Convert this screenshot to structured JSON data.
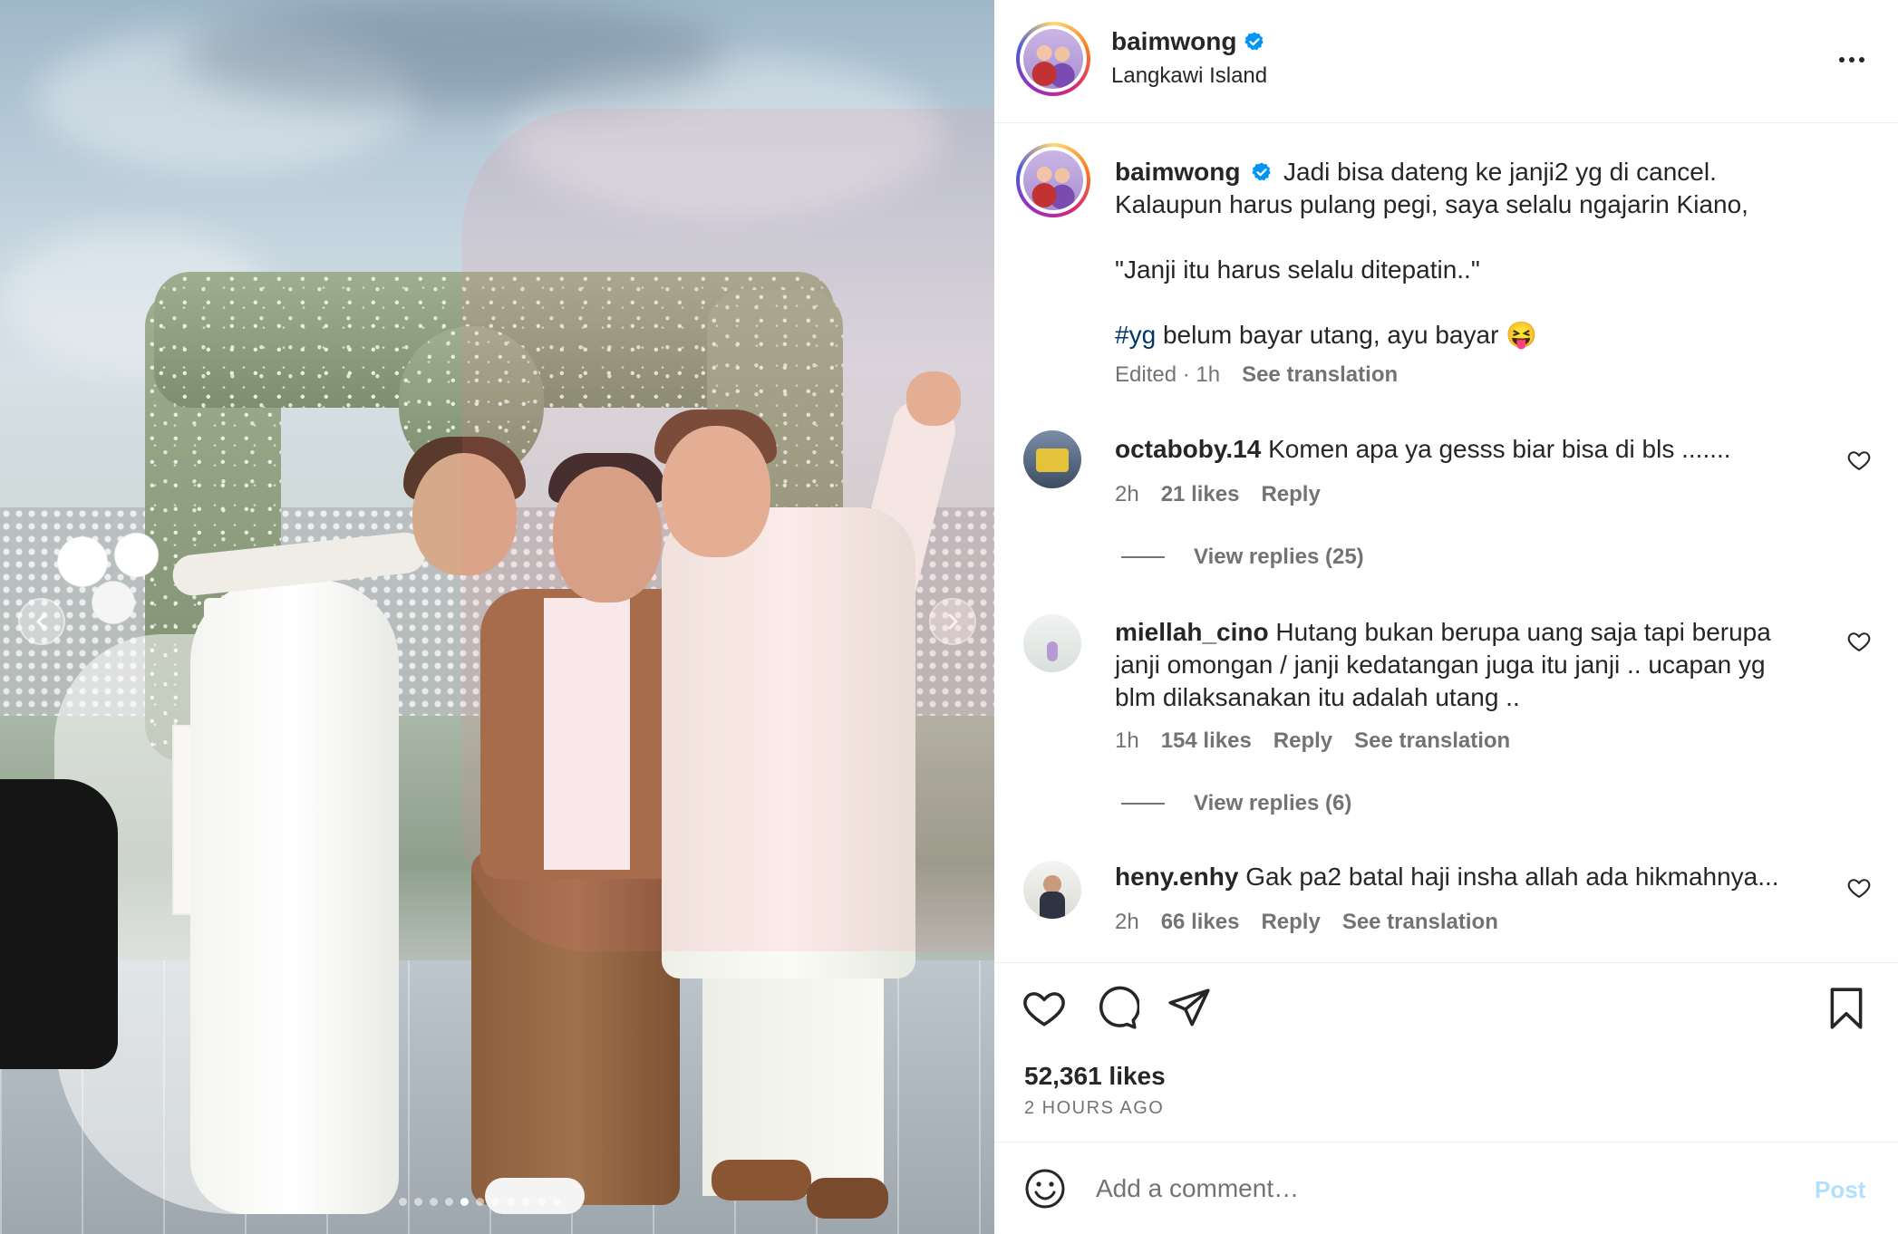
{
  "post": {
    "username": "baimwong",
    "location": "Langkawi Island",
    "caption": {
      "username": "baimwong",
      "line1": "Jadi bisa dateng ke janji2 yg di cancel.",
      "line2": "Kalaupun harus pulang pegi, saya selalu ngajarin Kiano,",
      "line3": "\"Janji itu harus selalu ditepatin..\"",
      "hashtag": "#yg",
      "line4_rest": "belum bayar utang, ayu bayar",
      "emoji": "😝",
      "edited": "Edited · 1h",
      "see_translation": "See translation"
    },
    "likes": "52,361 likes",
    "time_ago": "2 HOURS AGO"
  },
  "comments": [
    {
      "username": "octaboby.14",
      "text": "Komen apa ya gesss biar bisa di bls .......",
      "time": "2h",
      "likes": "21 likes",
      "reply": "Reply",
      "view_replies": "View replies (25)"
    },
    {
      "username": "miellah_cino",
      "text": "Hutang bukan berupa uang saja tapi berupa janji omongan / janji kedatangan juga itu janji .. ucapan yg blm dilaksanakan itu adalah utang ..",
      "time": "1h",
      "likes": "154 likes",
      "reply": "Reply",
      "see_translation": "See translation",
      "view_replies": "View replies (6)"
    },
    {
      "username": "heny.enhy",
      "text": "Gak pa2 batal haji insha allah ada hikmahnya...",
      "time": "2h",
      "likes": "66 likes",
      "reply": "Reply",
      "see_translation": "See translation"
    }
  ],
  "composer": {
    "placeholder": "Add a comment…",
    "post_label": "Post"
  },
  "carousel": {
    "slide_count": 11,
    "active_index": 4
  },
  "colors": {
    "link_blue": "#00376b",
    "verified_blue": "#0095f6",
    "post_disabled": "#b2dffc",
    "muted": "#737373"
  },
  "icons": [
    "verified-badge-icon",
    "more-options-icon",
    "heart-icon",
    "comment-icon",
    "share-icon",
    "bookmark-icon",
    "emoji-icon",
    "chevron-left-icon",
    "chevron-right-icon"
  ]
}
